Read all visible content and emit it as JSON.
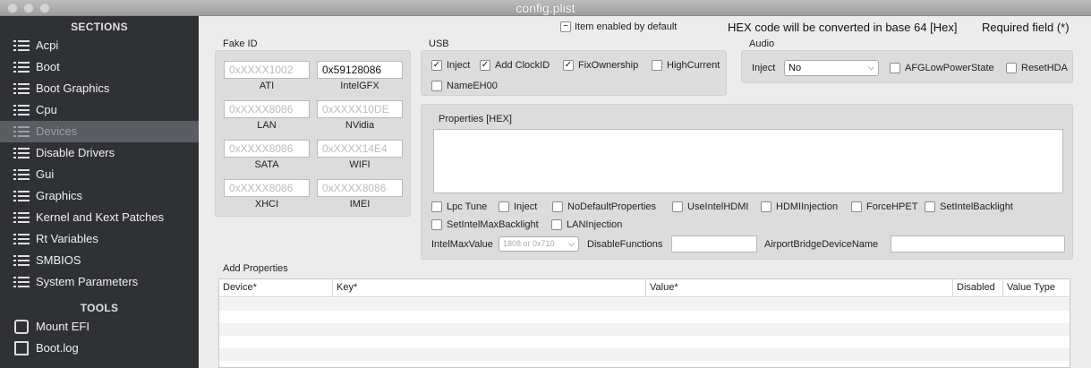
{
  "window": {
    "title": "config.plist"
  },
  "sidebar": {
    "sections_header": "SECTIONS",
    "items": [
      {
        "label": "Acpi"
      },
      {
        "label": "Boot"
      },
      {
        "label": "Boot Graphics"
      },
      {
        "label": "Cpu"
      },
      {
        "label": "Devices"
      },
      {
        "label": "Disable Drivers"
      },
      {
        "label": "Gui"
      },
      {
        "label": "Graphics"
      },
      {
        "label": "Kernel and Kext Patches"
      },
      {
        "label": "Rt Variables"
      },
      {
        "label": "SMBIOS"
      },
      {
        "label": "System Parameters"
      }
    ],
    "tools_header": "TOOLS",
    "tools": [
      {
        "label": "Mount EFI"
      },
      {
        "label": "Boot.log"
      }
    ]
  },
  "header": {
    "item_enabled": "Item enabled by default",
    "hex_note": "HEX code will be converted in base 64 [Hex]",
    "required": "Required field (*)"
  },
  "fake_id": {
    "title": "Fake ID",
    "fields": [
      {
        "value": "0xXXXX1002",
        "label": "ATI"
      },
      {
        "value": "0x59128086",
        "label": "IntelGFX"
      },
      {
        "value": "0xXXXX8086",
        "label": "LAN"
      },
      {
        "value": "0xXXXX10DE",
        "label": "NVidia"
      },
      {
        "value": "0xXXXX8086",
        "label": "SATA"
      },
      {
        "value": "0xXXXX14E4",
        "label": "WIFI"
      },
      {
        "value": "0xXXXX8086",
        "label": "XHCI"
      },
      {
        "value": "0xXXXX8086",
        "label": "IMEI"
      }
    ]
  },
  "usb": {
    "title": "USB",
    "options": [
      {
        "label": "Inject",
        "checked": "✓"
      },
      {
        "label": "Add ClockID",
        "checked": "✓"
      },
      {
        "label": "FixOwnership",
        "checked": "✓"
      },
      {
        "label": "HighCurrent",
        "checked": ""
      },
      {
        "label": "NameEH00",
        "checked": ""
      }
    ]
  },
  "audio": {
    "title": "Audio",
    "inject_label": "Inject",
    "inject_value": "No",
    "options": [
      {
        "label": "AFGLowPowerState"
      },
      {
        "label": "ResetHDA"
      }
    ]
  },
  "properties": {
    "title": "Properties [HEX]",
    "options": [
      {
        "label": "Lpc Tune"
      },
      {
        "label": "Inject"
      },
      {
        "label": "NoDefaultProperties"
      },
      {
        "label": "UseIntelHDMI"
      },
      {
        "label": "HDMIInjection"
      },
      {
        "label": "ForceHPET"
      },
      {
        "label": "SetIntelBacklight"
      },
      {
        "label": "SetIntelMaxBacklight"
      },
      {
        "label": "LANInjection"
      }
    ],
    "intel_max_label": "IntelMaxValue",
    "intel_max_placeholder": "1808 or 0x710",
    "disable_functions_label": "DisableFunctions",
    "airport_label": "AirportBridgeDeviceName"
  },
  "add_properties": {
    "title": "Add Properties",
    "columns": [
      "Device*",
      "Key*",
      "Value*",
      "Disabled",
      "Value Type"
    ]
  }
}
